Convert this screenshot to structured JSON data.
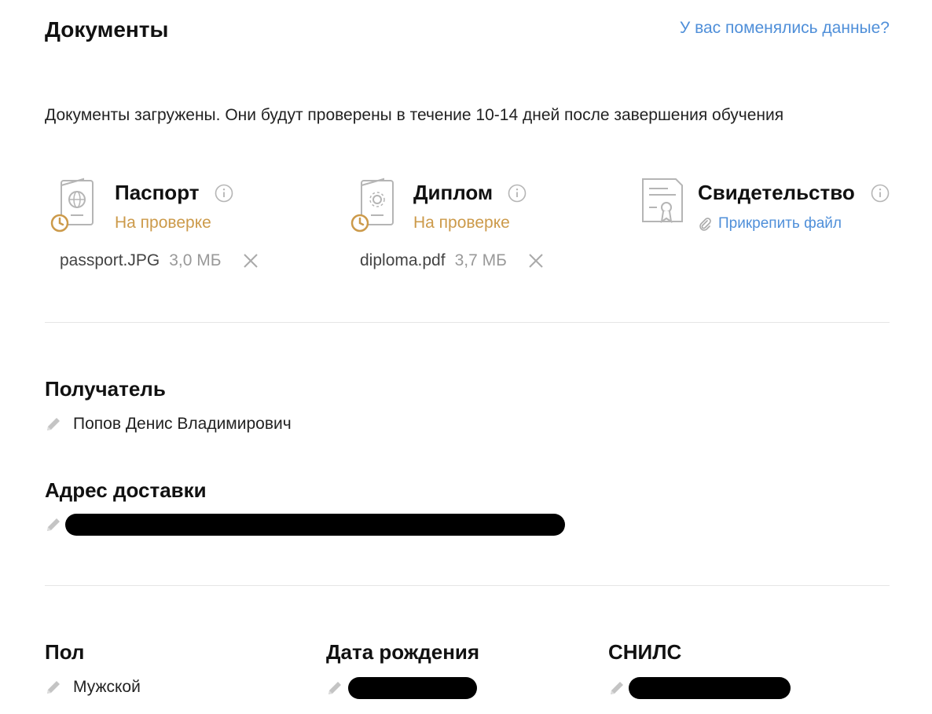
{
  "header": {
    "title": "Документы",
    "changed_link": "У вас поменялись данные?"
  },
  "notice": "Документы загружены. Они будут проверены в течение 10-14 дней после завершения обучения",
  "documents": {
    "passport": {
      "title": "Паспорт",
      "status": "На проверке",
      "file_name": "passport.JPG",
      "file_size": "3,0 МБ"
    },
    "diploma": {
      "title": "Диплом",
      "status": "На проверке",
      "file_name": "diploma.pdf",
      "file_size": "3,7 МБ"
    },
    "certificate": {
      "title": "Свидетельство",
      "attach_label": "Прикрепить файл"
    }
  },
  "recipient": {
    "label": "Получатель",
    "value": "Попов Денис Владимирович"
  },
  "address": {
    "label": "Адрес доставки"
  },
  "gender": {
    "label": "Пол",
    "value": "Мужской"
  },
  "birthdate": {
    "label": "Дата рождения"
  },
  "snils": {
    "label": "СНИЛС"
  },
  "colors": {
    "link": "#4f8fd9",
    "status_pending": "#cc9a4a",
    "icon_gray": "#b5b5b5"
  }
}
